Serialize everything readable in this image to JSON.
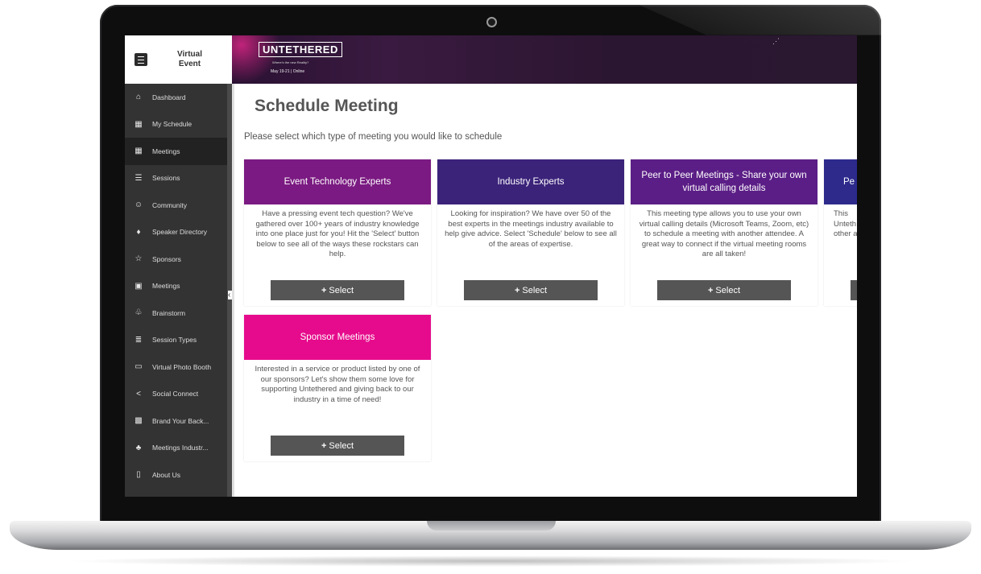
{
  "app": {
    "brand_title": "Virtual\nEvent"
  },
  "banner": {
    "logo": "UNTETHERED",
    "tagline": "Where's the new Reality?",
    "date": "May 19-21 | Online"
  },
  "sidebar": {
    "items": [
      {
        "label": "Dashboard",
        "icon": "home-icon"
      },
      {
        "label": "My Schedule",
        "icon": "calendar-icon"
      },
      {
        "label": "Meetings",
        "icon": "calendar-icon",
        "active": true
      },
      {
        "label": "Sessions",
        "icon": "list-icon"
      },
      {
        "label": "Community",
        "icon": "users-icon"
      },
      {
        "label": "Speaker Directory",
        "icon": "microphone-icon"
      },
      {
        "label": "Sponsors",
        "icon": "star-icon"
      },
      {
        "label": "Meetings",
        "icon": "calendar-plus-icon"
      },
      {
        "label": "Brainstorm",
        "icon": "sitemap-icon"
      },
      {
        "label": "Session Types",
        "icon": "list-ordered-icon"
      },
      {
        "label": "Virtual Photo Booth",
        "icon": "photo-icon"
      },
      {
        "label": "Social Connect",
        "icon": "share-icon"
      },
      {
        "label": "Brand Your Back...",
        "icon": "image-icon"
      },
      {
        "label": "Meetings Industr...",
        "icon": "hands-icon"
      },
      {
        "label": "About Us",
        "icon": "book-icon"
      }
    ]
  },
  "main": {
    "title": "Schedule Meeting",
    "intro": "Please select which type of meeting you would like to schedule",
    "cards": [
      {
        "title": "Event Technology Experts",
        "color": "#7b1a82",
        "description": "Have a pressing event tech question? We've gathered over 100+ years of industry knowledge into one place just for you! Hit the 'Select' button below to see all of the ways these rockstars can help.",
        "button": "Select"
      },
      {
        "title": "Industry Experts",
        "color": "#3b237a",
        "description": "Looking for inspiration? We have over 50 of the best experts in the meetings industry available to help give advice. Select 'Schedule' below to see all of the areas of expertise.",
        "button": "Select"
      },
      {
        "title": "Peer to Peer Meetings - Share your own virtual calling details",
        "color": "#5b1e86",
        "description": "This meeting type allows you to use your own virtual calling details (Microsoft Teams, Zoom, etc) to schedule a meeting with another attendee. A great way to connect if the virtual meeting rooms are all taken!",
        "button": "Select"
      },
      {
        "title": "Pe",
        "color": "#2d2a8c",
        "description": "This Unteth other a",
        "button": ""
      },
      {
        "title": "Sponsor Meetings",
        "color": "#e60b8c",
        "description": "Interested in a service or product listed by one of our sponsors? Let's show them some love for supporting Untethered and giving back to our industry in a time of need!",
        "button": "Select"
      }
    ]
  }
}
